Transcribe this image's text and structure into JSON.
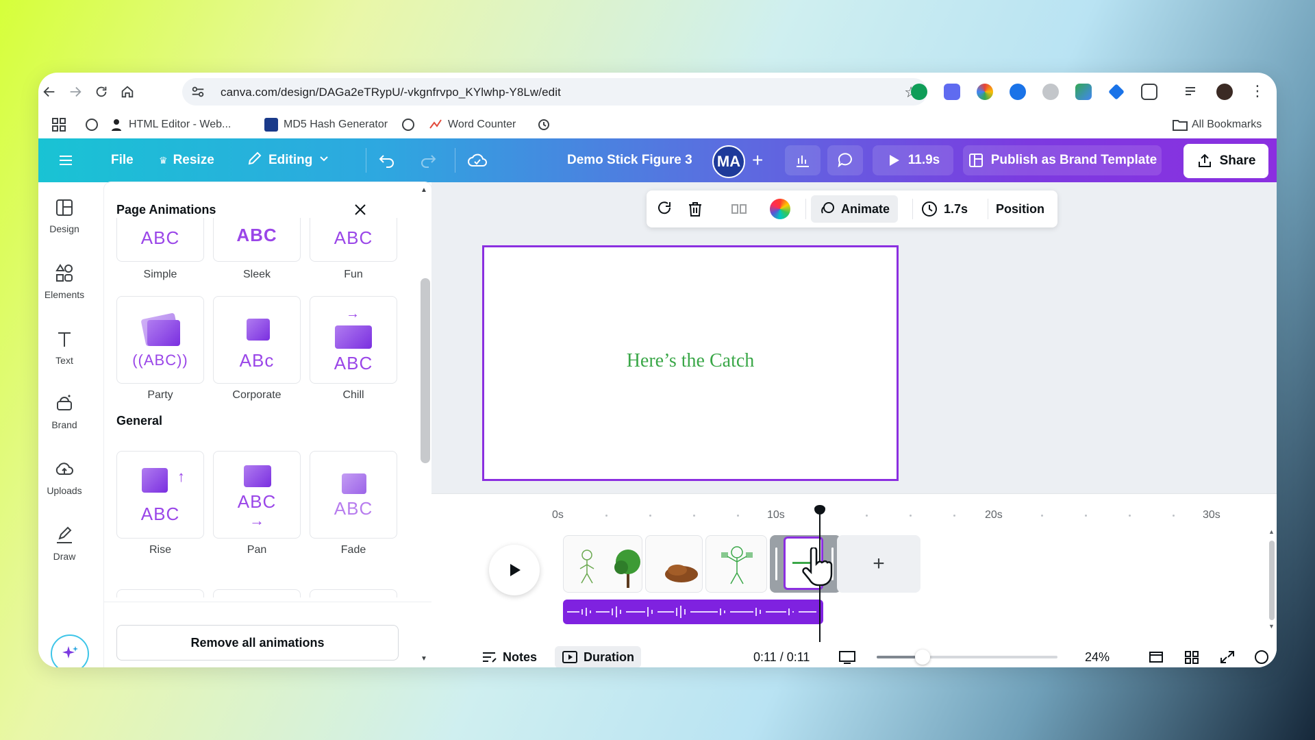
{
  "browser": {
    "url": "canva.com/design/DAGa2eTRypU/-vkgnfrvpo_KYlwhp-Y8Lw/edit",
    "bookmarks": [
      {
        "label": "HTML Editor - Web..."
      },
      {
        "label": "MD5 Hash Generator"
      },
      {
        "label": "Word Counter"
      }
    ],
    "all_bookmarks": "All Bookmarks"
  },
  "header": {
    "file": "File",
    "resize": "Resize",
    "editing": "Editing",
    "design_title": "Demo Stick Figure 3",
    "avatar_initials": "MA",
    "play_duration": "11.9s",
    "publish": "Publish as Brand Template",
    "share": "Share"
  },
  "rail": {
    "items": [
      {
        "label": "Design"
      },
      {
        "label": "Elements"
      },
      {
        "label": "Text"
      },
      {
        "label": "Brand"
      },
      {
        "label": "Uploads"
      },
      {
        "label": "Draw"
      }
    ]
  },
  "panel": {
    "title": "Page Animations",
    "abc": "ABC",
    "top_row": [
      {
        "label": "Simple"
      },
      {
        "label": "Sleek"
      },
      {
        "label": "Fun"
      }
    ],
    "second_row": [
      {
        "label": "Party"
      },
      {
        "label": "Corporate"
      },
      {
        "label": "Chill"
      }
    ],
    "party_text": "((ABC))",
    "corporate_text": "ABc",
    "general_title": "General",
    "general_row": [
      {
        "label": "Rise"
      },
      {
        "label": "Pan"
      },
      {
        "label": "Fade"
      }
    ],
    "remove_all": "Remove all animations"
  },
  "context_toolbar": {
    "animate": "Animate",
    "duration": "1.7s",
    "position": "Position"
  },
  "canvas": {
    "text": "Here’s the Catch"
  },
  "timeline": {
    "ticks": [
      "0s",
      "10s",
      "20s",
      "30s"
    ],
    "add_label": "+",
    "notes": "Notes",
    "duration": "Duration",
    "time_readout": "0:11 / 0:11",
    "zoom": "24%"
  },
  "colors": {
    "brand_purple": "#8b2fe0",
    "canvas_text": "#3aa748",
    "audio_track": "#7f22e0"
  }
}
